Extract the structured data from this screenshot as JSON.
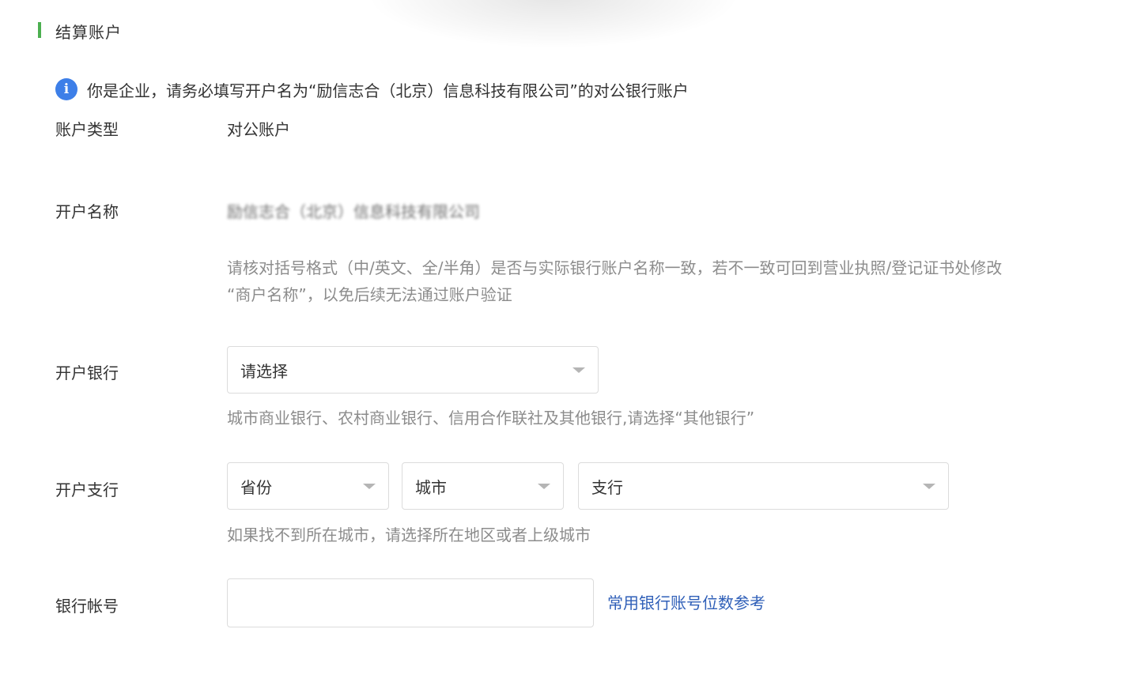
{
  "section": {
    "title": "结算账户"
  },
  "notice": {
    "text": "你是企业，请务必填写开户名为“励信志合（北京）信息科技有限公司”的对公银行账户"
  },
  "account_type": {
    "label": "账户类型",
    "value": "对公账户"
  },
  "account_name": {
    "label": "开户名称",
    "value": "励信志合（北京）信息科技有限公司",
    "hint_line1": "请核对括号格式（中/英文、全/半角）是否与实际银行账户名称一致，若不一致可回到营业执照/登记证书处修改",
    "hint_line2": "“商户名称”，以免后续无法通过账户验证"
  },
  "bank": {
    "label": "开户银行",
    "select_value": "请选择",
    "hint": "城市商业银行、农村商业银行、信用合作联社及其他银行,请选择“其他银行”"
  },
  "branch": {
    "label": "开户支行",
    "province": "省份",
    "city": "城市",
    "branch": "支行",
    "hint": "如果找不到所在城市，请选择所在地区或者上级城市"
  },
  "account_number": {
    "label": "银行帐号",
    "value": "",
    "link": "常用银行账号位数参考"
  },
  "colors": {
    "accent": "#4caf50",
    "info": "#3d7fe8",
    "link": "#2f5fb8",
    "hint": "#8c8c8c"
  }
}
